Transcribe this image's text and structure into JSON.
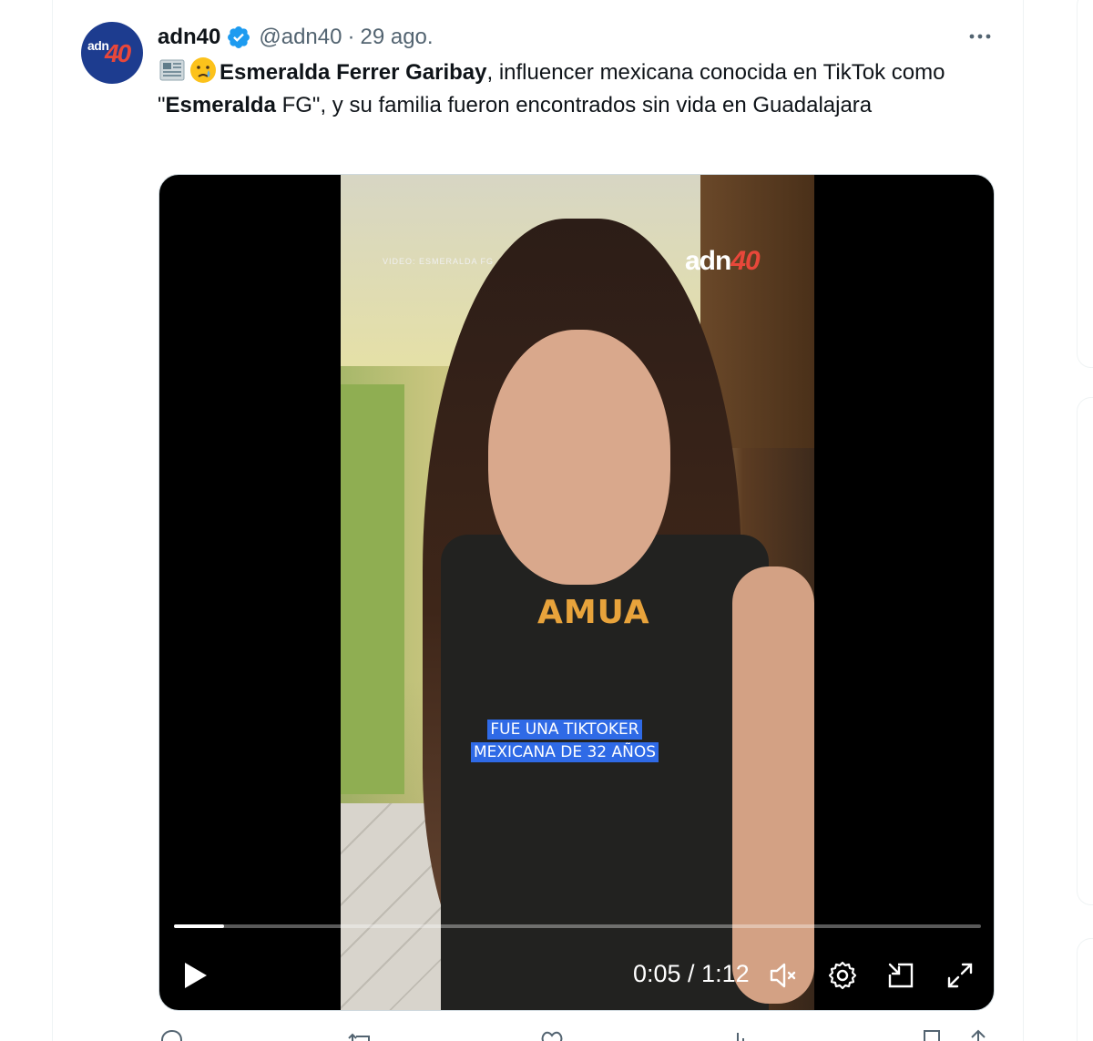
{
  "tweet": {
    "display_name": "adn40",
    "handle": "@adn40",
    "separator": "·",
    "date": "29 ago.",
    "text": {
      "bold_1": "Esmeralda Ferrer Garibay",
      "part_1": ", influencer mexicana conocida en TikTok como \"",
      "bold_2": "Esmeralda",
      "part_2": " FG\", y su familia fueron encontrados sin vida en Guadalajara"
    },
    "emojis": [
      "newspaper-icon",
      "crying-face-icon"
    ]
  },
  "video": {
    "watermark_prefix": "adn",
    "watermark_suffix": "40",
    "shirt_text": "AMUA",
    "caption_line_1": "FUE UNA TIKTOKER",
    "caption_line_2": "MEXICANA DE 32 AÑOS",
    "credit": "VIDEO: ESMERALDA FG",
    "time": "0:05 / 1:12",
    "progress": 0.062
  },
  "colors": {
    "verified": "#1d9bf0",
    "caption_bg": "#2f6ae6",
    "brand_red": "#e8473a",
    "brand_blue": "#1d3c8f"
  },
  "controls": [
    "play-icon",
    "mute-icon",
    "settings-icon",
    "pip-icon",
    "fullscreen-icon"
  ],
  "actions": [
    "reply-icon",
    "repost-icon",
    "like-icon",
    "views-icon",
    "bookmark-icon",
    "share-icon"
  ]
}
